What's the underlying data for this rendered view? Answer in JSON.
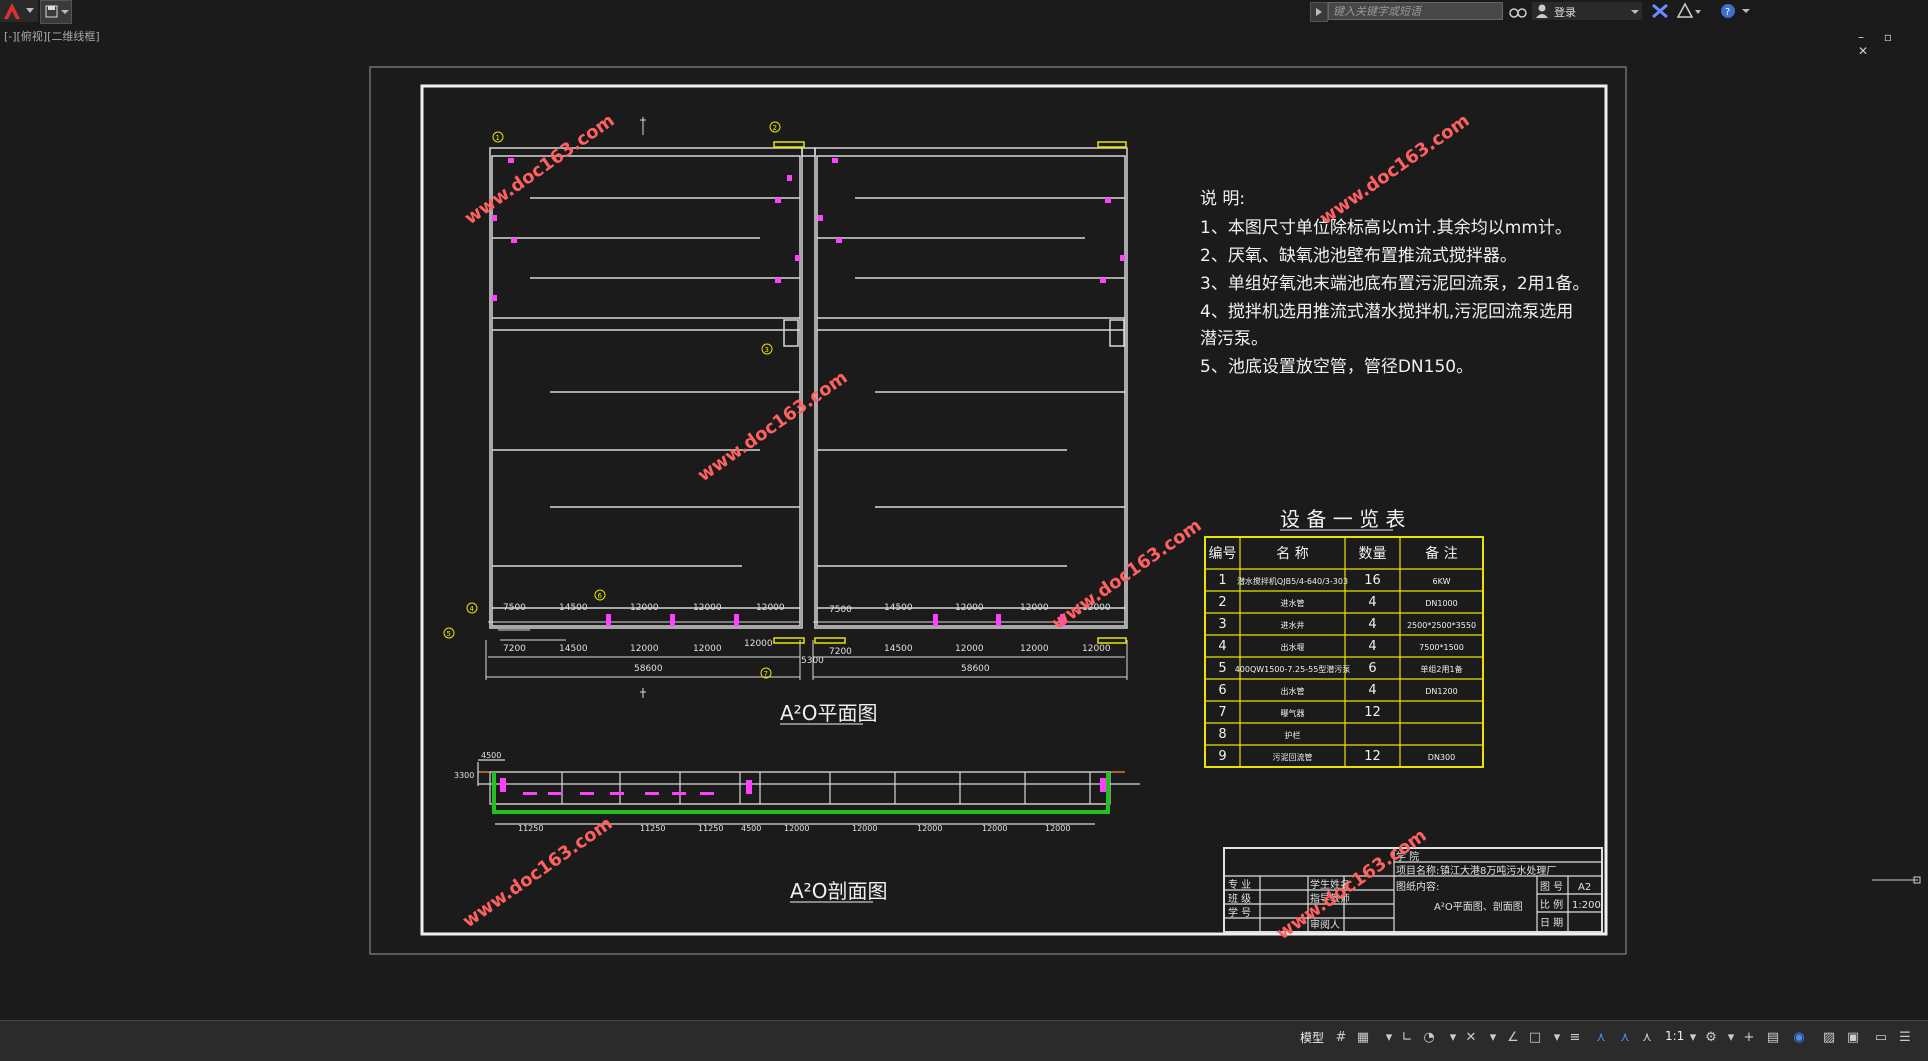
{
  "app": {
    "search_placeholder": "键入关键字或短语",
    "login_label": "登录",
    "view_label": "[-][俯视][二维线框]",
    "model_tab": "模型",
    "scale": "1:1",
    "window_controls": "– ▫ ✕"
  },
  "drawing": {
    "plan_title": "A²O平面图",
    "section_title": "A²O剖面图",
    "notes_title": "说 明:",
    "notes": [
      "1、本图尺寸单位除标高以m计.其余均以mm计。",
      "2、厌氧、缺氧池池壁布置推流式搅拌器。",
      "3、单组好氧池末端池底布置污泥回流泵，2用1备。",
      "4、搅拌机选用推流式潜水搅拌机,污泥回流泵选用",
      "潜污泵。",
      "5、池底设置放空管，管径DN150。"
    ],
    "watermark": "www.doc163.com",
    "plan_dims_top": [
      "7500",
      "14500",
      "12000",
      "12000",
      "12000"
    ],
    "plan_dims_top_right": [
      "7500",
      "14500",
      "12000",
      "12000",
      "12000"
    ],
    "plan_dims_bottom": [
      "7200",
      "14500",
      "12000",
      "12000",
      "12000"
    ],
    "plan_dims_bottom_right": [
      "7200",
      "14500",
      "12000",
      "12000",
      "12000"
    ],
    "plan_total_left": "58600",
    "plan_total_right": "58600",
    "plan_gap": "5300",
    "section_dims": [
      "11250",
      "11250",
      "11250",
      "4500",
      "12000",
      "12000",
      "12000",
      "12000",
      "12000"
    ],
    "section_top_dim": "4500",
    "section_side_dim": "3300",
    "markers": [
      "1",
      "2",
      "3",
      "4",
      "5",
      "6",
      "7"
    ]
  },
  "equipment_table": {
    "title": "设 备 一 览 表",
    "headers": [
      "编号",
      "名 称",
      "数量",
      "备 注"
    ],
    "rows": [
      [
        "1",
        "潜水搅拌机QJB5/4-640/3-303",
        "16",
        "6KW"
      ],
      [
        "2",
        "进水管",
        "4",
        "DN1000"
      ],
      [
        "3",
        "进水井",
        "4",
        "2500*2500*3550"
      ],
      [
        "4",
        "出水堰",
        "4",
        "7500*1500"
      ],
      [
        "5",
        "400QW1500-7.25-55型潜污泵",
        "6",
        "单组2用1备"
      ],
      [
        "6",
        "出水管",
        "4",
        "DN1200"
      ],
      [
        "7",
        "曝气器",
        "12",
        ""
      ],
      [
        "8",
        "护栏",
        "",
        ""
      ],
      [
        "9",
        "污泥回流管",
        "12",
        "DN300"
      ]
    ]
  },
  "title_block": {
    "school_label": "学 院",
    "project_label": "项目名称:",
    "project_value": "镇江大港8万吨污水处理厂",
    "major_label": "专 业",
    "class_label": "班 级",
    "id_label": "学 号",
    "student_label": "学生姓名",
    "teacher_label": "指导教师",
    "reviewer_label": "审阅人",
    "content_label": "图纸内容:",
    "content_value": "A²O平面图、剖面图",
    "sheet_label": "图 号",
    "sheet_value": "A2",
    "scale_label": "比 例",
    "scale_value": "1:200",
    "date_label": "日 期"
  },
  "colors": {
    "background": "#1b1b1b",
    "lines": "#e6e6e6",
    "yellow": "#e8e400",
    "magenta": "#ff40ff",
    "green": "#22c022",
    "watermark": "#ff6060"
  }
}
